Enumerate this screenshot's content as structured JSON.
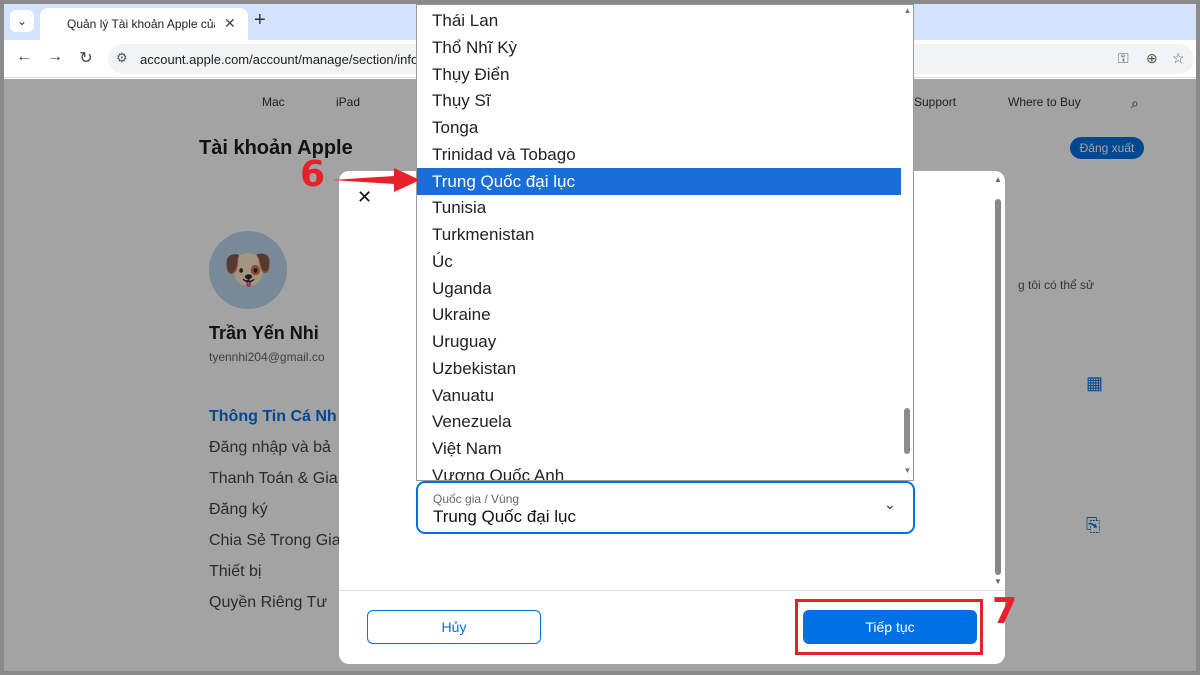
{
  "browser": {
    "tab_title": "Quản lý Tài khoản Apple của ba",
    "new_tab": "+",
    "url": "account.apple.com/account/manage/section/infor"
  },
  "apple_nav": {
    "items": [
      "Mac",
      "iPad",
      "Support",
      "Where to Buy"
    ]
  },
  "page": {
    "title": "Tài khoản Apple",
    "logout_label": "Đăng xuất",
    "user_name": "Trần Yến Nhi",
    "user_email": "tyennhi204@gmail.co",
    "right_hint": "g tôi có thể sử",
    "sidebar": [
      "Thông Tin Cá Nh",
      "Đăng nhập và bả",
      "Thanh Toán & Gia",
      "Đăng ký",
      "Chia Sẻ Trong Gia",
      "Thiết bị",
      "Quyền Riêng Tư"
    ]
  },
  "dropdown": {
    "options": [
      "Thái Lan",
      "Thổ Nhĩ Kỳ",
      "Thụy Điển",
      "Thụy Sĩ",
      "Tonga",
      "Trinidad và Tobago",
      "Trung Quốc đại lục",
      "Tunisia",
      "Turkmenistan",
      "Úc",
      "Uganda",
      "Ukraine",
      "Uruguay",
      "Uzbekistan",
      "Vanuatu",
      "Venezuela",
      "Việt Nam",
      "Vương Quốc Anh"
    ],
    "selected_index": 6
  },
  "select": {
    "label": "Quốc gia / Vùng",
    "value": "Trung Quốc đại lục"
  },
  "modal": {
    "close_icon": "close-icon",
    "cancel_label": "Hủy",
    "continue_label": "Tiếp tục"
  },
  "annotations": {
    "step6": "6",
    "step7": "7",
    "color": "#e8202a"
  },
  "colors": {
    "accent": "#0071e3",
    "selected_option": "#1a6ed8",
    "tabbar": "#d3e3fd"
  }
}
